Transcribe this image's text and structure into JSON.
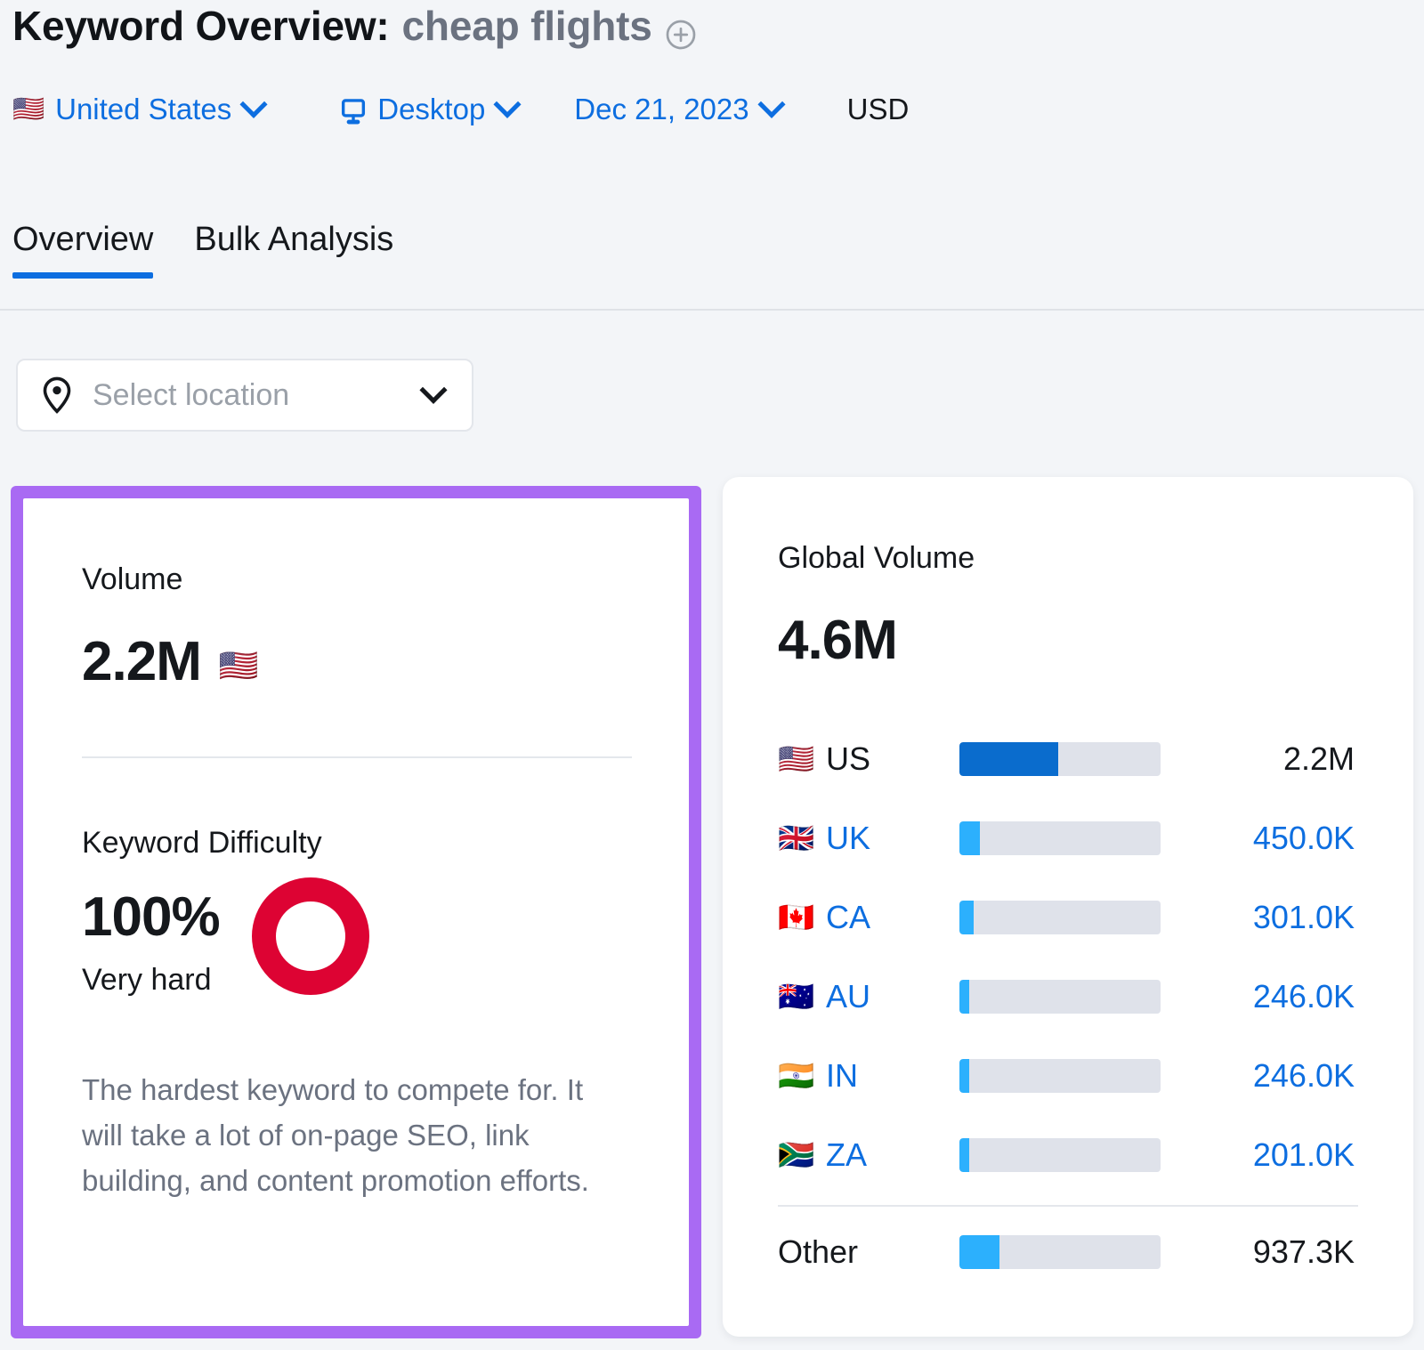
{
  "header": {
    "title_prefix": "Keyword Overview:",
    "keyword": "cheap flights",
    "add_icon": "plus-circle-icon",
    "country": "United States",
    "country_flag": "🇺🇸",
    "device": "Desktop",
    "device_icon": "desktop-monitor-icon",
    "date": "Dec 21, 2023",
    "currency": "USD"
  },
  "tabs": [
    {
      "label": "Overview",
      "active": true
    },
    {
      "label": "Bulk Analysis",
      "active": false
    }
  ],
  "location_select": {
    "icon": "map-pin-icon",
    "placeholder": "Select location",
    "caret": "chevron-down-icon"
  },
  "volume_card": {
    "highlighted": true,
    "highlight_color": "#a96af3",
    "volume_label": "Volume",
    "volume_value": "2.2M",
    "volume_flag": "🇺🇸",
    "difficulty_label": "Keyword Difficulty",
    "difficulty_value": "100%",
    "difficulty_level": "Very hard",
    "difficulty_color": "#dd0333",
    "difficulty_description": "The hardest keyword to compete for. It will take a lot of on-page SEO, link building, and content promotion efforts."
  },
  "global_volume_card": {
    "label": "Global Volume",
    "value": "4.6M"
  },
  "chart_data": {
    "type": "bar",
    "title": "Global Volume",
    "total": "4.6M",
    "orientation": "horizontal",
    "xlabel": "",
    "ylabel": "",
    "grid": false,
    "legend": false,
    "categories": [
      "US",
      "UK",
      "CA",
      "AU",
      "IN",
      "ZA",
      "Other"
    ],
    "values": [
      2200000,
      450000,
      301000,
      246000,
      246000,
      201000,
      937300
    ],
    "value_labels": [
      "2.2M",
      "450.0K",
      "301.0K",
      "246.0K",
      "246.0K",
      "201.0K",
      "937.3K"
    ],
    "bar_percents": [
      49,
      10,
      7,
      5,
      5,
      5,
      20
    ],
    "flags": [
      "🇺🇸",
      "🇬🇧",
      "🇨🇦",
      "🇦🇺",
      "🇮🇳",
      "🇿🇦",
      ""
    ],
    "series_colors": [
      "#0a6ccd",
      "#2cb0fd",
      "#2cb0fd",
      "#2cb0fd",
      "#2cb0fd",
      "#2cb0fd",
      "#2cb0fd"
    ],
    "track_color": "#dfe2ea",
    "rows": [
      {
        "flag": "🇺🇸",
        "code": "US",
        "value": "2.2M",
        "percent": 49,
        "highlight": true
      },
      {
        "flag": "🇬🇧",
        "code": "UK",
        "value": "450.0K",
        "percent": 10,
        "highlight": false
      },
      {
        "flag": "🇨🇦",
        "code": "CA",
        "value": "301.0K",
        "percent": 7,
        "highlight": false
      },
      {
        "flag": "🇦🇺",
        "code": "AU",
        "value": "246.0K",
        "percent": 5,
        "highlight": false
      },
      {
        "flag": "🇮🇳",
        "code": "IN",
        "value": "246.0K",
        "percent": 5,
        "highlight": false
      },
      {
        "flag": "🇿🇦",
        "code": "ZA",
        "value": "201.0K",
        "percent": 5,
        "highlight": false
      },
      {
        "flag": "",
        "code": "Other",
        "value": "937.3K",
        "percent": 20,
        "highlight": true
      }
    ]
  }
}
